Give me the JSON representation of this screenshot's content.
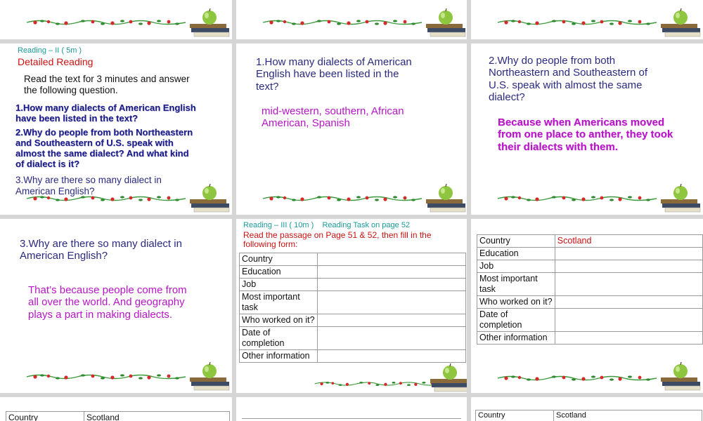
{
  "deck": {
    "slide4": {
      "section": "Reading – II ( 5m )",
      "heading": "Detailed Reading",
      "instruction": "Read the text for 3 minutes and answer\nthe following question.",
      "q1": "1.How many dialects of American English\n  have been listed in the text?",
      "q2": "2.Why do people from both Northeastern\n  and Southeastern of U.S. speak with\n  almost  the same dialect? And what kind\n  of dialect is it?",
      "q3": "3.Why are there so many dialect in\n  American English?"
    },
    "slide5": {
      "question": "1.How many dialects of American\n  English have been listed in the\n  text?",
      "answer": "mid-western, southern, African\n American, Spanish"
    },
    "slide6": {
      "question": "2.Why do people from both\n  Northeastern and Southeastern of\n  U.S. speak with almost  the same\n  dialect?",
      "answer": "Because when Americans moved\nfrom one place to anther, they took\ntheir dialects with them."
    },
    "slide7": {
      "question": "3.Why are there so many dialect in\n  American English?",
      "answer": "That’s because people come from\nall over the world. And geography\nplays a part in making dialects."
    },
    "slide8": {
      "section": "Reading – III ( 10m )    Reading Task on page 52",
      "instruction": "Read the passage on Page 51 & 52, then fill in the\nfollowing form:",
      "rows": [
        "Country",
        "Education",
        "Job",
        "Most important task",
        "Who worked on it?",
        "Date of completion",
        "Other information"
      ]
    },
    "slide9": {
      "country_label": "Country",
      "country_value": "Scotland",
      "rows": [
        "Education",
        "Job",
        "Most important task",
        "Who worked on it?",
        "Date of completion",
        "Other information"
      ]
    },
    "slide10": {
      "country_label": "Country",
      "country_value": "Scotland"
    },
    "slide12": {
      "country_label": "Country",
      "country_value": "Scotland"
    }
  },
  "colors": {
    "background": "#d6d6d6",
    "teal": "#1a9a9a",
    "red": "#cc1111",
    "navy": "#2a2a80",
    "magenta": "#b815c8"
  },
  "icons": [
    "vine-border",
    "apple-on-books-icon"
  ]
}
